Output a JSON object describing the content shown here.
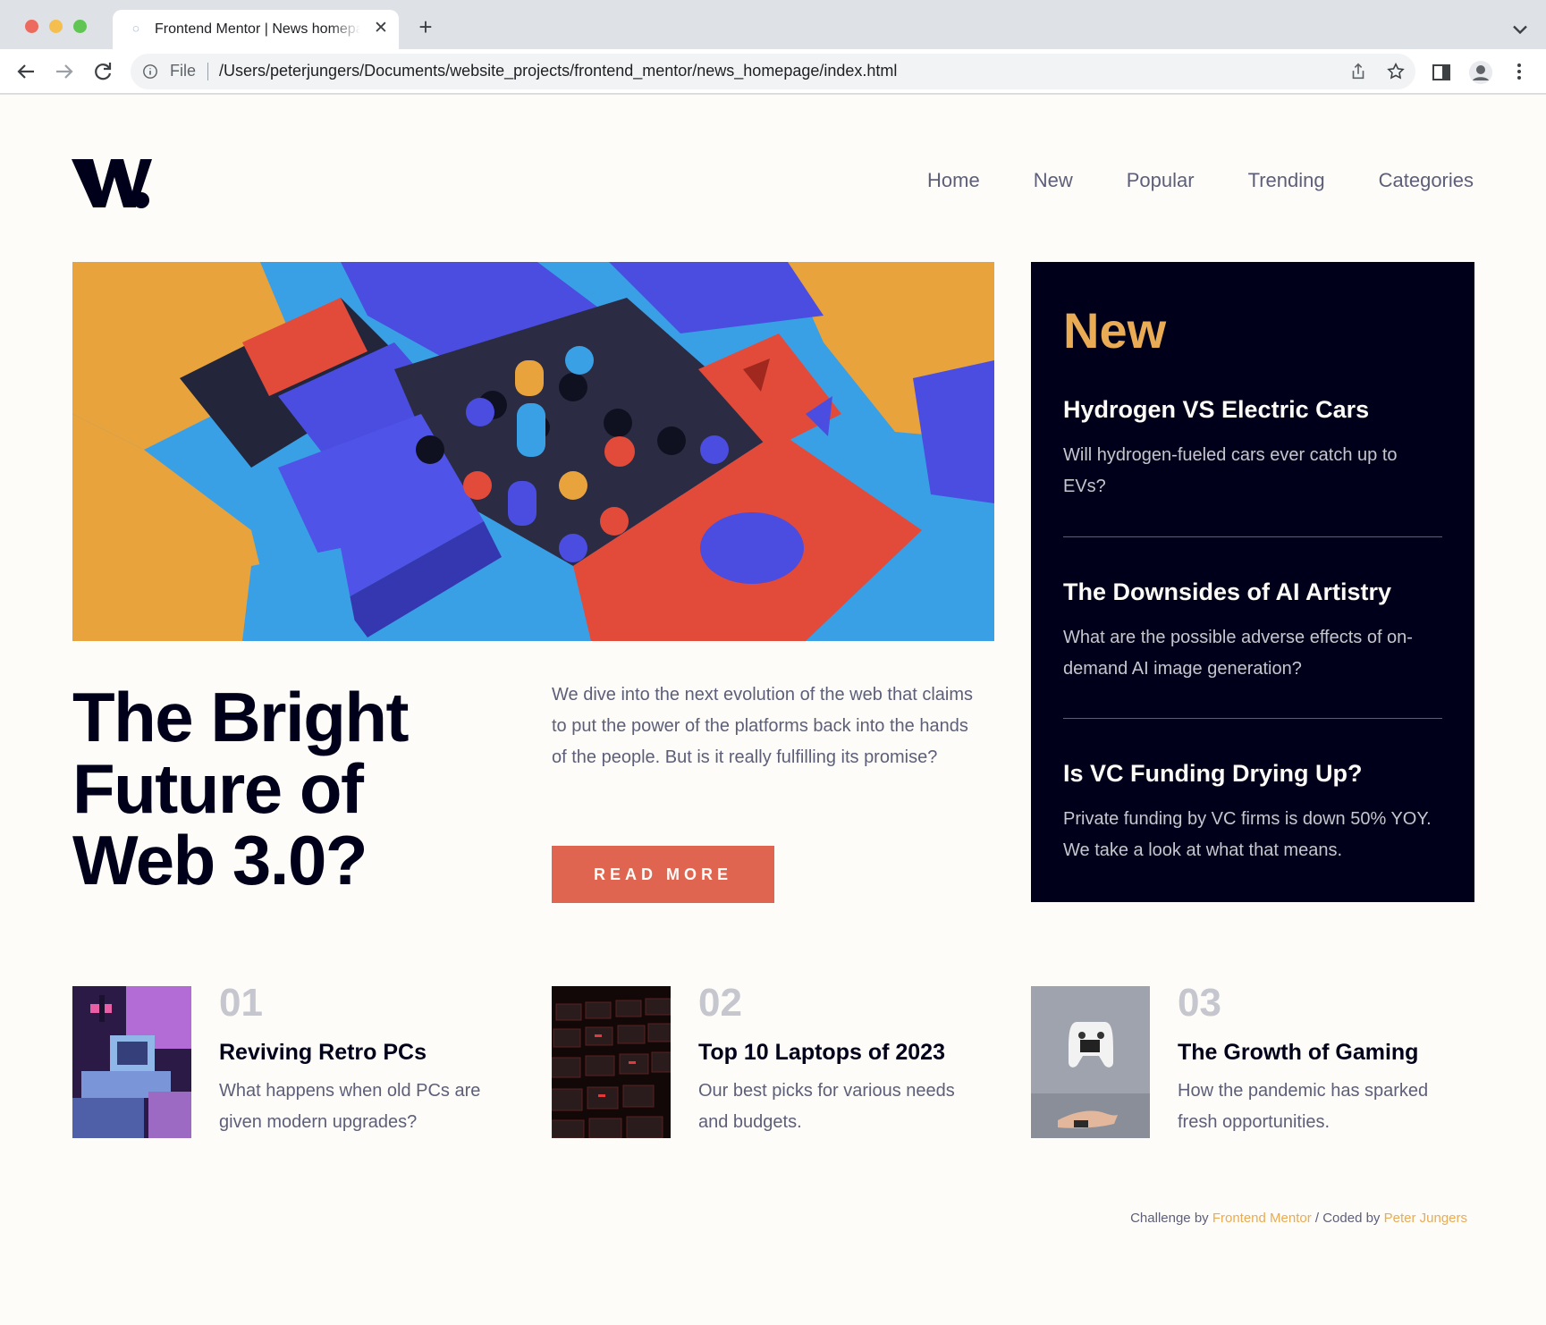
{
  "browser": {
    "tab_title": "Frontend Mentor | News homepage",
    "address_scheme_label": "File",
    "url": "/Users/peterjungers/Documents/website_projects/frontend_mentor/news_homepage/index.html",
    "new_tab_symbol": "+",
    "close_symbol": "✕"
  },
  "page": {
    "colors": {
      "background": "#fdfcf8",
      "dark": "#00001a",
      "accent_red": "#e06551",
      "accent_orange": "#e9ab53",
      "muted": "#5d5f79",
      "light_muted": "#c5c6ce"
    },
    "nav": [
      "Home",
      "New",
      "Popular",
      "Trending",
      "Categories"
    ],
    "hero": {
      "title": "The Bright Future of Web 3.0?",
      "description": "We dive into the next evolution of the web that claims to put the power of the platforms back into the hands of the people. But is it really fulfilling its promise?",
      "button": "READ MORE"
    },
    "new_section": {
      "heading": "New",
      "items": [
        {
          "title": "Hydrogen VS Electric Cars",
          "text": "Will hydrogen-fueled cars ever catch up to EVs?"
        },
        {
          "title": "The Downsides of AI Artistry",
          "text": "What are the possible adverse effects of on-demand AI image generation?"
        },
        {
          "title": "Is VC Funding Drying Up?",
          "text": "Private funding by VC firms is down 50% YOY. We take a look at what that means."
        }
      ]
    },
    "cards": [
      {
        "number": "01",
        "title": "Reviving Retro PCs",
        "text": "What happens when old PCs are given modern upgrades?"
      },
      {
        "number": "02",
        "title": "Top 10 Laptops of 2023",
        "text": "Our best picks for various needs and budgets."
      },
      {
        "number": "03",
        "title": "The Growth of Gaming",
        "text": "How the pandemic has sparked fresh opportunities."
      }
    ],
    "attribution": {
      "prefix": "Challenge by",
      "link1": "Frontend Mentor",
      "middle": "/ Coded by",
      "link2": "Peter Jungers"
    }
  }
}
